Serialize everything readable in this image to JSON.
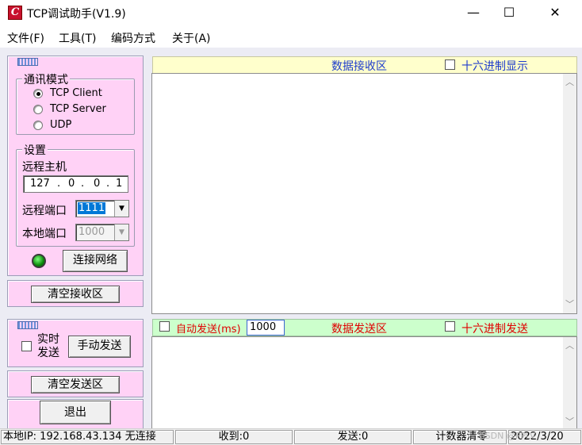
{
  "window": {
    "title": "TCP调试助手(V1.9)",
    "icon_letter": "C",
    "controls": {
      "minimize": "—",
      "maximize": "☐",
      "close": "✕"
    }
  },
  "menu": [
    "文件(F)",
    "工具(T)",
    "编码方式",
    "关于(A)"
  ],
  "comm_mode": {
    "title": "通讯模式",
    "options": [
      "TCP Client",
      "TCP Server",
      "UDP"
    ],
    "selected": "TCP Client"
  },
  "settings": {
    "title": "设置",
    "remote_host_label": "远程主机",
    "ip_octets": [
      "127",
      "0",
      "0",
      "1"
    ],
    "remote_port_label": "远程端口",
    "remote_port_value": "1111",
    "local_port_label": "本地端口",
    "local_port_value": "1000",
    "status_led_color": "#0a8a0a",
    "connect_button": "连接网络"
  },
  "clear_receive_button": "清空接收区",
  "send_panel": {
    "realtime_send_label_line1": "实时",
    "realtime_send_label_line2": "发送",
    "manual_send_button": "手动发送",
    "clear_send_button": "清空发送区",
    "exit_button": "退出"
  },
  "receive_area": {
    "title": "数据接收区",
    "hex_display_label": "十六进制显示",
    "title_color": "#1e3ccc"
  },
  "send_area": {
    "auto_send_label": "自动发送(ms)",
    "interval_value": "1000",
    "title": "数据发送区",
    "hex_send_label": "十六进制发送",
    "title_color": "#e00000"
  },
  "status": {
    "local_ip": "本地IP: 192.168.43.134 无连接",
    "received": "收到:0",
    "sent": "发送:0",
    "counter_reset": "计数器清零",
    "date": "2022/3/20",
    "watermark": "CSDN @PPLV"
  }
}
